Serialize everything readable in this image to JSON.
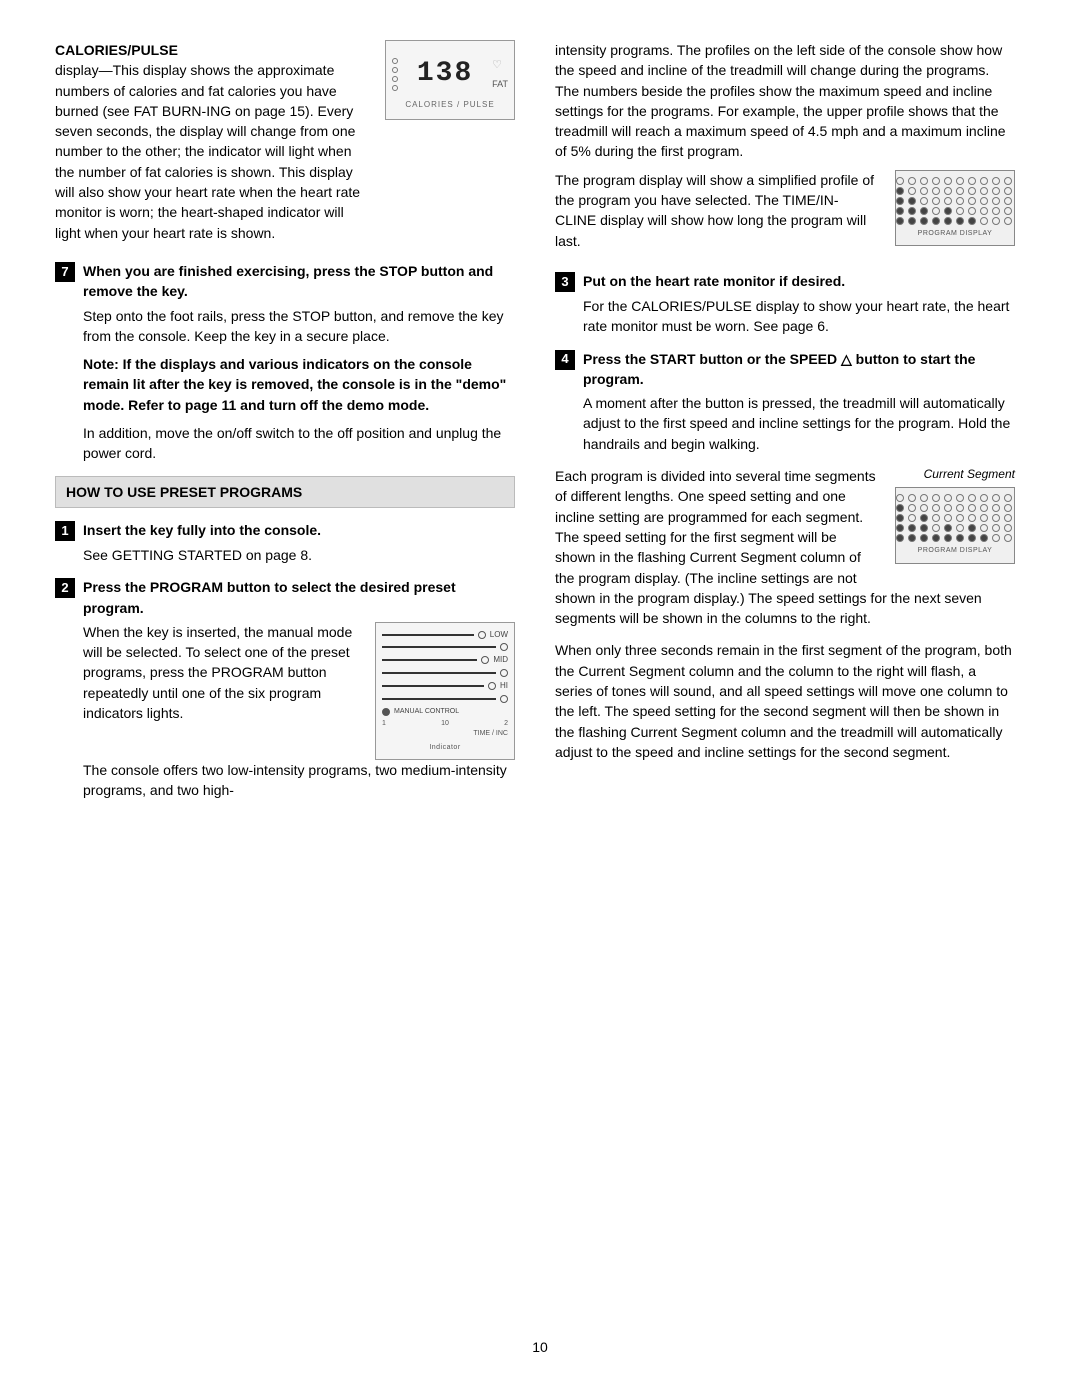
{
  "page": {
    "number": "10",
    "left_col": {
      "calories_pulse": {
        "heading": "CALORIES/PULSE",
        "display_number": "138",
        "display_fat": "FAT",
        "display_label": "CALORIES / PULSE",
        "para1": "display—This display shows the approximate numbers of calories and fat calories you have burned (see FAT BURN-ING on page 15). Every seven seconds, the display will change from one number to the other; the indicator will light when the number of fat calories is shown. This display will also show your heart rate when the heart rate monitor is worn; the heart-shaped indicator will light when your heart rate is shown."
      },
      "step7": {
        "num": "7",
        "title": "When you are finished exercising, press the STOP button and remove the key.",
        "body1": "Step onto the foot rails, press the STOP button, and remove the key from the console. Keep the key in a secure place.",
        "note": "Note: If the displays and various indicators on the console remain lit after the key is removed, the console is in the \"demo\" mode. Refer to page 11 and turn off the demo mode.",
        "body2": "In addition, move the on/off switch to the off position and unplug the power cord."
      },
      "preset_header": "HOW TO USE PRESET PROGRAMS",
      "step1": {
        "num": "1",
        "title": "Insert the key fully into the console.",
        "body": "See GETTING STARTED on page 8."
      },
      "step2": {
        "num": "2",
        "title": "Press the PROGRAM button to select the desired preset program.",
        "body1": "When the key is inserted, the manual mode will be selected. To select one of the preset programs, press the PROGRAM button repeatedly until one of the six program indicators lights.",
        "indicator_label": "Indicator",
        "indicator_labels": [
          "LOW",
          "MID",
          "HI",
          "MANUAL CONTROL"
        ],
        "body2": "The console offers two low-intensity programs, two medium-intensity programs, and two high-"
      }
    },
    "right_col": {
      "para_intensity": "intensity programs. The profiles on the left side of the console show how the speed and incline of the treadmill will change during the programs. The numbers beside the profiles show the maximum speed and incline settings for the programs. For example, the upper profile shows that the treadmill will reach a maximum speed of 4.5 mph and a maximum incline of 5% during the first program.",
      "para_program_display": "The program display will show a simplified profile of the program you have selected. The TIME/IN-CLINE display will show how long the program will last.",
      "step3": {
        "num": "3",
        "title": "Put on the heart rate monitor if desired.",
        "body": "For the CALORIES/PULSE display to show your heart rate, the heart rate monitor must be worn. See page 6."
      },
      "step4": {
        "num": "4",
        "title": "Press the START button or the SPEED △ button to start the program.",
        "body": "A moment after the button is pressed, the treadmill will automatically adjust to the first speed and incline settings for the program. Hold the handrails and begin walking."
      },
      "current_segment_label": "Current Segment",
      "para_segments": "Each program is divided into several time segments of different lengths. One speed setting and one incline setting are programmed for each segment. The speed setting for the first segment will be shown in the flashing Current Segment column of the program display. (The incline settings are not shown in the program display.) The speed settings for the next seven segments will be shown in the columns to the right.",
      "para_flash": "When only three seconds remain in the first segment of the program, both the Current Segment column and the column to the right will flash, a series of tones will sound, and all speed settings will move one column to the left. The speed setting for the second segment will then be shown in the flashing Current Segment column and the treadmill will automatically adjust to the speed and incline settings for the second segment."
    }
  }
}
